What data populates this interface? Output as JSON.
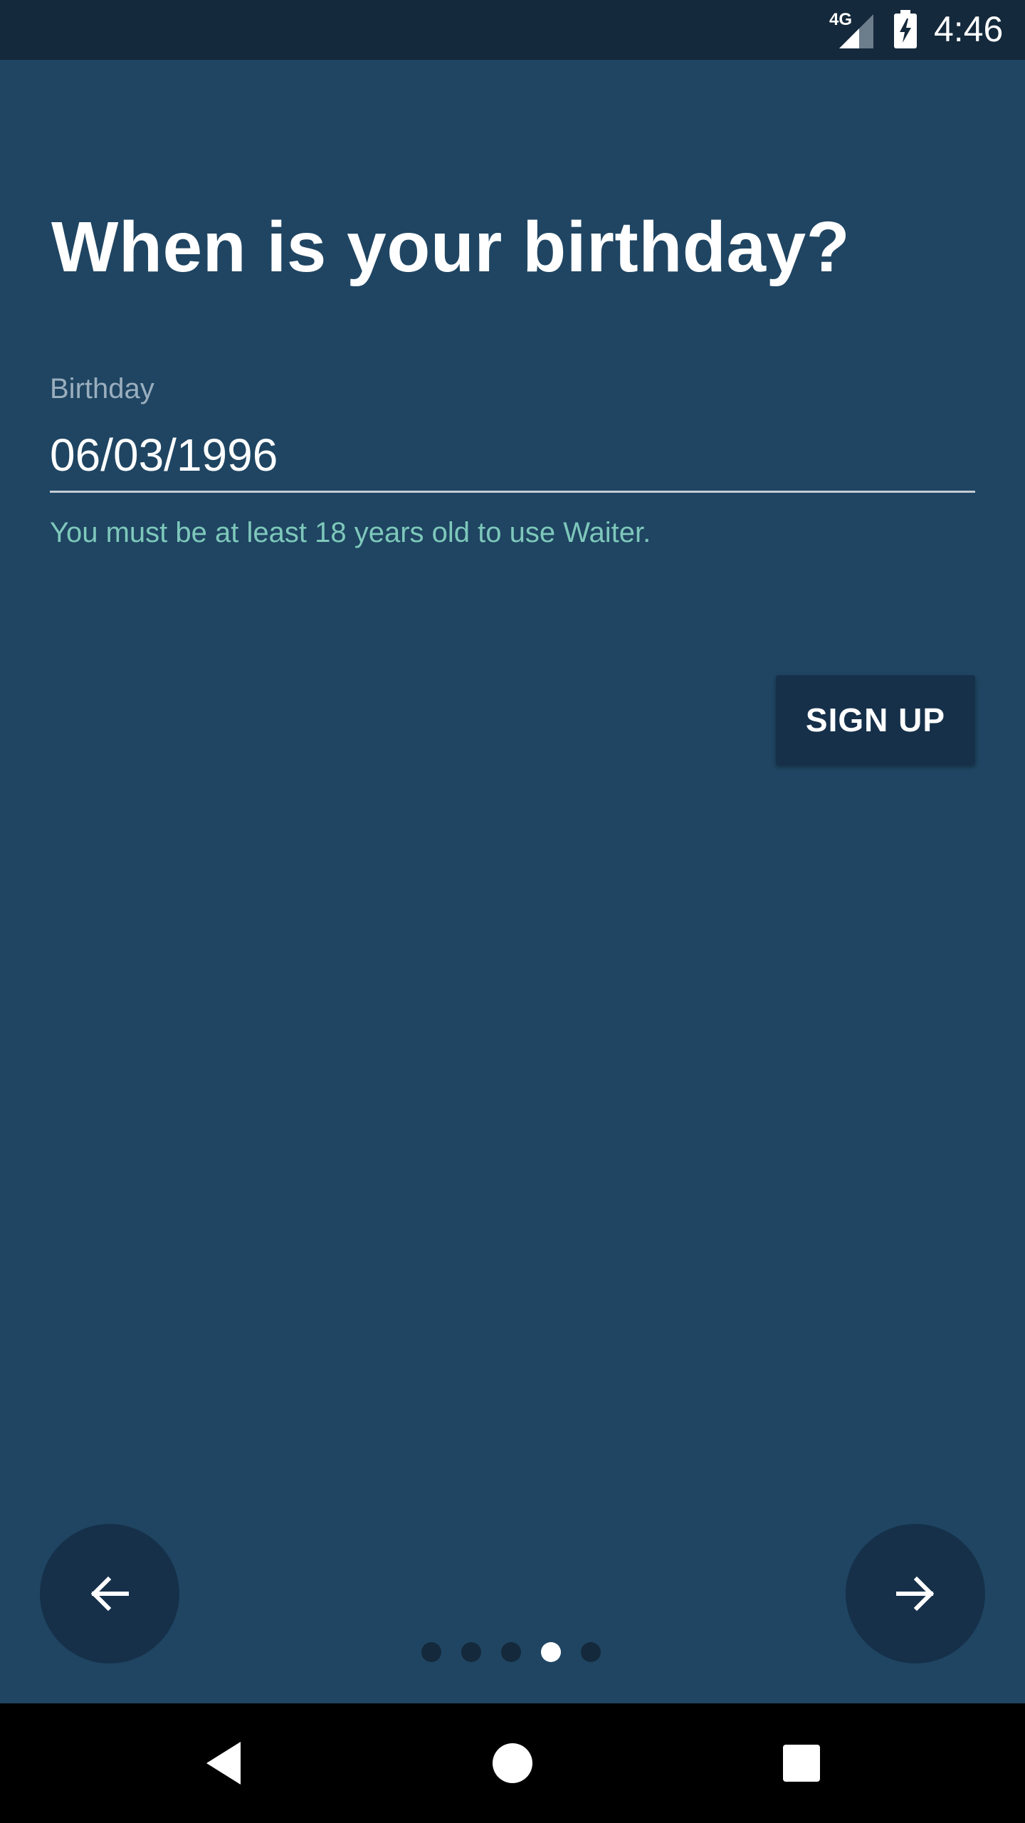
{
  "status_bar": {
    "network_label": "4G",
    "time": "4:46"
  },
  "page": {
    "title": "When is your birthday?"
  },
  "birthday_field": {
    "label": "Birthday",
    "value": "06/03/1996",
    "helper_text": "You must be at least 18 years old to use Waiter."
  },
  "actions": {
    "signup_label": "SIGN UP"
  },
  "pager": {
    "total_pages": 5,
    "current_page": 4
  },
  "colors": {
    "background": "#1f4562",
    "status_bar": "#14293b",
    "button": "#16304a",
    "helper_text": "#7ec8bb"
  },
  "icons": {
    "back": "arrow-left-icon",
    "next": "arrow-right-icon",
    "nav_back": "triangle-back-icon",
    "nav_home": "circle-home-icon",
    "nav_recents": "square-recents-icon"
  }
}
